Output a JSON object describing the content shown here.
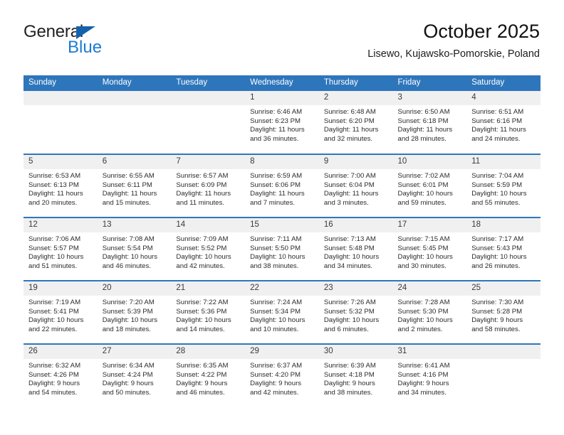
{
  "brand": {
    "name_part1": "General",
    "name_part2": "Blue",
    "accent_color": "#1a7cd1",
    "triangle_color": "#1462ab"
  },
  "header": {
    "title": "October 2025",
    "subtitle": "Lisewo, Kujawsko-Pomorskie, Poland"
  },
  "theme": {
    "header_blue": "#2e76bc",
    "daynum_gray": "#f0f0f0",
    "text": "#2b2b2b"
  },
  "weekdays": [
    "Sunday",
    "Monday",
    "Tuesday",
    "Wednesday",
    "Thursday",
    "Friday",
    "Saturday"
  ],
  "weeks": [
    [
      {
        "day": "",
        "sunrise": "",
        "sunset": "",
        "daylight1": "",
        "daylight2": ""
      },
      {
        "day": "",
        "sunrise": "",
        "sunset": "",
        "daylight1": "",
        "daylight2": ""
      },
      {
        "day": "",
        "sunrise": "",
        "sunset": "",
        "daylight1": "",
        "daylight2": ""
      },
      {
        "day": "1",
        "sunrise": "Sunrise: 6:46 AM",
        "sunset": "Sunset: 6:23 PM",
        "daylight1": "Daylight: 11 hours",
        "daylight2": "and 36 minutes."
      },
      {
        "day": "2",
        "sunrise": "Sunrise: 6:48 AM",
        "sunset": "Sunset: 6:20 PM",
        "daylight1": "Daylight: 11 hours",
        "daylight2": "and 32 minutes."
      },
      {
        "day": "3",
        "sunrise": "Sunrise: 6:50 AM",
        "sunset": "Sunset: 6:18 PM",
        "daylight1": "Daylight: 11 hours",
        "daylight2": "and 28 minutes."
      },
      {
        "day": "4",
        "sunrise": "Sunrise: 6:51 AM",
        "sunset": "Sunset: 6:16 PM",
        "daylight1": "Daylight: 11 hours",
        "daylight2": "and 24 minutes."
      }
    ],
    [
      {
        "day": "5",
        "sunrise": "Sunrise: 6:53 AM",
        "sunset": "Sunset: 6:13 PM",
        "daylight1": "Daylight: 11 hours",
        "daylight2": "and 20 minutes."
      },
      {
        "day": "6",
        "sunrise": "Sunrise: 6:55 AM",
        "sunset": "Sunset: 6:11 PM",
        "daylight1": "Daylight: 11 hours",
        "daylight2": "and 15 minutes."
      },
      {
        "day": "7",
        "sunrise": "Sunrise: 6:57 AM",
        "sunset": "Sunset: 6:09 PM",
        "daylight1": "Daylight: 11 hours",
        "daylight2": "and 11 minutes."
      },
      {
        "day": "8",
        "sunrise": "Sunrise: 6:59 AM",
        "sunset": "Sunset: 6:06 PM",
        "daylight1": "Daylight: 11 hours",
        "daylight2": "and 7 minutes."
      },
      {
        "day": "9",
        "sunrise": "Sunrise: 7:00 AM",
        "sunset": "Sunset: 6:04 PM",
        "daylight1": "Daylight: 11 hours",
        "daylight2": "and 3 minutes."
      },
      {
        "day": "10",
        "sunrise": "Sunrise: 7:02 AM",
        "sunset": "Sunset: 6:01 PM",
        "daylight1": "Daylight: 10 hours",
        "daylight2": "and 59 minutes."
      },
      {
        "day": "11",
        "sunrise": "Sunrise: 7:04 AM",
        "sunset": "Sunset: 5:59 PM",
        "daylight1": "Daylight: 10 hours",
        "daylight2": "and 55 minutes."
      }
    ],
    [
      {
        "day": "12",
        "sunrise": "Sunrise: 7:06 AM",
        "sunset": "Sunset: 5:57 PM",
        "daylight1": "Daylight: 10 hours",
        "daylight2": "and 51 minutes."
      },
      {
        "day": "13",
        "sunrise": "Sunrise: 7:08 AM",
        "sunset": "Sunset: 5:54 PM",
        "daylight1": "Daylight: 10 hours",
        "daylight2": "and 46 minutes."
      },
      {
        "day": "14",
        "sunrise": "Sunrise: 7:09 AM",
        "sunset": "Sunset: 5:52 PM",
        "daylight1": "Daylight: 10 hours",
        "daylight2": "and 42 minutes."
      },
      {
        "day": "15",
        "sunrise": "Sunrise: 7:11 AM",
        "sunset": "Sunset: 5:50 PM",
        "daylight1": "Daylight: 10 hours",
        "daylight2": "and 38 minutes."
      },
      {
        "day": "16",
        "sunrise": "Sunrise: 7:13 AM",
        "sunset": "Sunset: 5:48 PM",
        "daylight1": "Daylight: 10 hours",
        "daylight2": "and 34 minutes."
      },
      {
        "day": "17",
        "sunrise": "Sunrise: 7:15 AM",
        "sunset": "Sunset: 5:45 PM",
        "daylight1": "Daylight: 10 hours",
        "daylight2": "and 30 minutes."
      },
      {
        "day": "18",
        "sunrise": "Sunrise: 7:17 AM",
        "sunset": "Sunset: 5:43 PM",
        "daylight1": "Daylight: 10 hours",
        "daylight2": "and 26 minutes."
      }
    ],
    [
      {
        "day": "19",
        "sunrise": "Sunrise: 7:19 AM",
        "sunset": "Sunset: 5:41 PM",
        "daylight1": "Daylight: 10 hours",
        "daylight2": "and 22 minutes."
      },
      {
        "day": "20",
        "sunrise": "Sunrise: 7:20 AM",
        "sunset": "Sunset: 5:39 PM",
        "daylight1": "Daylight: 10 hours",
        "daylight2": "and 18 minutes."
      },
      {
        "day": "21",
        "sunrise": "Sunrise: 7:22 AM",
        "sunset": "Sunset: 5:36 PM",
        "daylight1": "Daylight: 10 hours",
        "daylight2": "and 14 minutes."
      },
      {
        "day": "22",
        "sunrise": "Sunrise: 7:24 AM",
        "sunset": "Sunset: 5:34 PM",
        "daylight1": "Daylight: 10 hours",
        "daylight2": "and 10 minutes."
      },
      {
        "day": "23",
        "sunrise": "Sunrise: 7:26 AM",
        "sunset": "Sunset: 5:32 PM",
        "daylight1": "Daylight: 10 hours",
        "daylight2": "and 6 minutes."
      },
      {
        "day": "24",
        "sunrise": "Sunrise: 7:28 AM",
        "sunset": "Sunset: 5:30 PM",
        "daylight1": "Daylight: 10 hours",
        "daylight2": "and 2 minutes."
      },
      {
        "day": "25",
        "sunrise": "Sunrise: 7:30 AM",
        "sunset": "Sunset: 5:28 PM",
        "daylight1": "Daylight: 9 hours",
        "daylight2": "and 58 minutes."
      }
    ],
    [
      {
        "day": "26",
        "sunrise": "Sunrise: 6:32 AM",
        "sunset": "Sunset: 4:26 PM",
        "daylight1": "Daylight: 9 hours",
        "daylight2": "and 54 minutes."
      },
      {
        "day": "27",
        "sunrise": "Sunrise: 6:34 AM",
        "sunset": "Sunset: 4:24 PM",
        "daylight1": "Daylight: 9 hours",
        "daylight2": "and 50 minutes."
      },
      {
        "day": "28",
        "sunrise": "Sunrise: 6:35 AM",
        "sunset": "Sunset: 4:22 PM",
        "daylight1": "Daylight: 9 hours",
        "daylight2": "and 46 minutes."
      },
      {
        "day": "29",
        "sunrise": "Sunrise: 6:37 AM",
        "sunset": "Sunset: 4:20 PM",
        "daylight1": "Daylight: 9 hours",
        "daylight2": "and 42 minutes."
      },
      {
        "day": "30",
        "sunrise": "Sunrise: 6:39 AM",
        "sunset": "Sunset: 4:18 PM",
        "daylight1": "Daylight: 9 hours",
        "daylight2": "and 38 minutes."
      },
      {
        "day": "31",
        "sunrise": "Sunrise: 6:41 AM",
        "sunset": "Sunset: 4:16 PM",
        "daylight1": "Daylight: 9 hours",
        "daylight2": "and 34 minutes."
      },
      {
        "day": "",
        "sunrise": "",
        "sunset": "",
        "daylight1": "",
        "daylight2": ""
      }
    ]
  ]
}
